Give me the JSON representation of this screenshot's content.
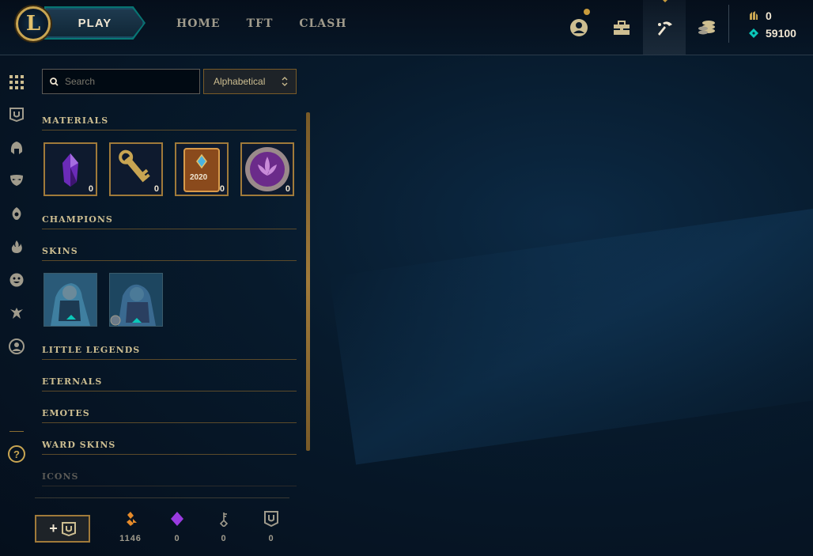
{
  "nav": {
    "play_label": "PLAY",
    "links": [
      "HOME",
      "TFT",
      "CLASH"
    ],
    "icons": [
      "profile-icon",
      "collection-icon",
      "loot-icon",
      "store-icon"
    ]
  },
  "wallet": {
    "rp": "0",
    "be": "59100"
  },
  "leftbar": [
    "grid-icon",
    "loot-chest-icon",
    "champion-helmet-icon",
    "mask-icon",
    "ward-icon",
    "flame-icon",
    "emote-icon",
    "spirit-icon",
    "profile-circle-icon",
    "help-icon"
  ],
  "help_label": "?",
  "search": {
    "placeholder": "Search"
  },
  "sort": {
    "selected": "Alphabetical"
  },
  "sections": {
    "materials": "MATERIALS",
    "champions": "CHAMPIONS",
    "skins": "SKINS",
    "little_legends": "LITTLE LEGENDS",
    "eternals": "ETERNALS",
    "emotes": "EMOTES",
    "ward_skins": "WARD SKINS",
    "icons": "ICONS"
  },
  "materials": [
    {
      "icon": "purple-gem-icon",
      "count": "0"
    },
    {
      "icon": "hextech-key-icon",
      "count": "0"
    },
    {
      "icon": "event-pass-2020-icon",
      "count": "0",
      "badge": "2020"
    },
    {
      "icon": "orb-icon",
      "count": "0"
    }
  ],
  "bottom": {
    "blue_essence": "1146",
    "gemstones": "0",
    "key_fragments": "0",
    "chests": "0"
  },
  "colors": {
    "gold": "#c8a552",
    "teal": "#0ac8b9",
    "text": "#cdbe91"
  }
}
